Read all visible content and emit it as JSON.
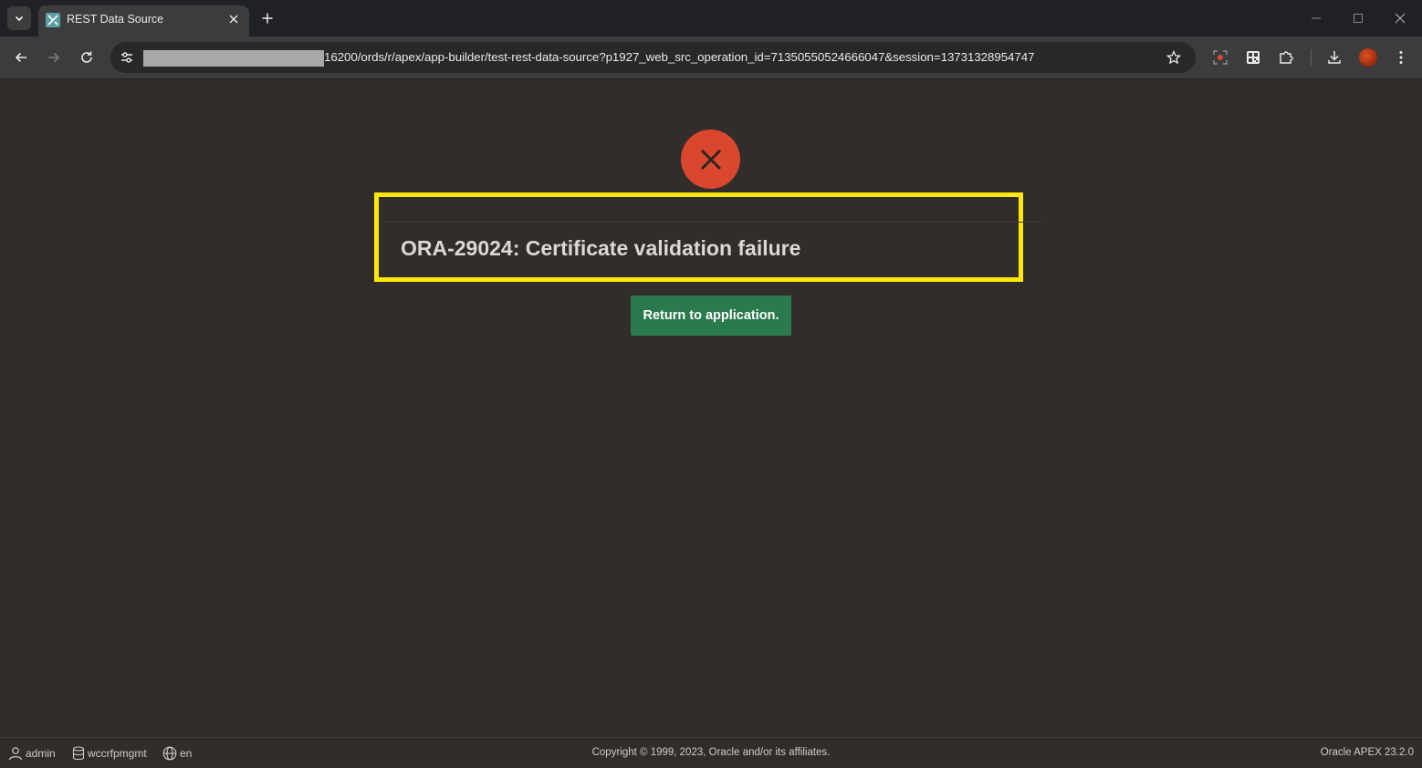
{
  "browser": {
    "tab": {
      "title": "REST Data Source"
    },
    "url": "16200/ords/r/apex/app-builder/test-rest-data-source?p1927_web_src_operation_id=71350550524666047&session=13731328954747"
  },
  "error": {
    "message": "ORA-29024: Certificate validation failure",
    "icon": "close-icon",
    "icon_color": "#d9472e",
    "highlight_color": "#ffe70a"
  },
  "actions": {
    "return_label": "Return to application.",
    "return_color": "#2b7a4e"
  },
  "footer": {
    "user": "admin",
    "workspace": "wccrfpmgmt",
    "language": "en",
    "copyright": "Copyright © 1999, 2023, Oracle and/or its affiliates.",
    "version": "Oracle APEX 23.2.0"
  }
}
